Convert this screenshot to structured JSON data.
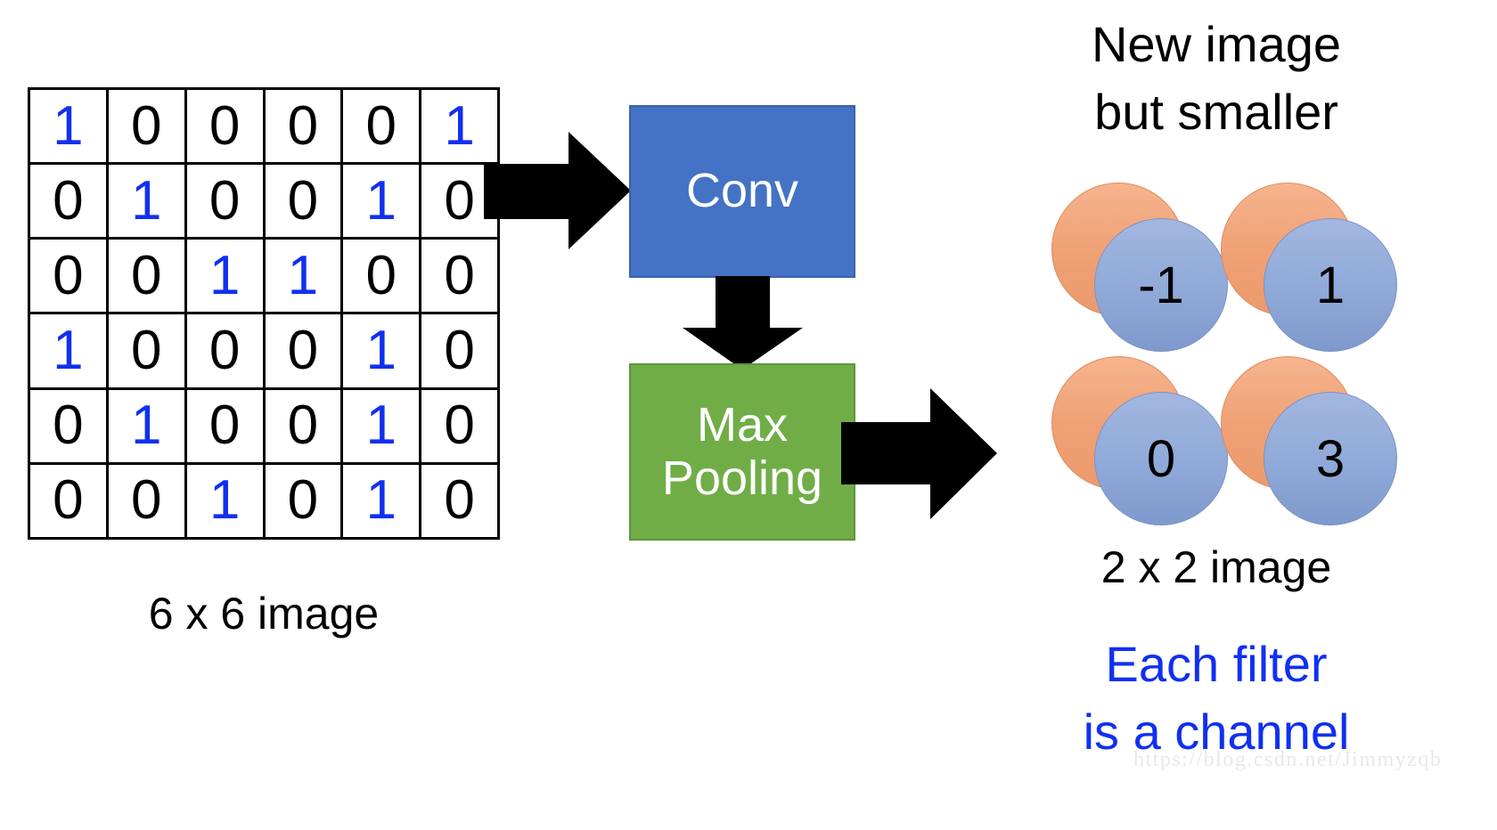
{
  "diagram": {
    "title_implicit": "CNN Conv + Max Pooling pipeline",
    "input": {
      "caption": "6 x 6 image",
      "rows": [
        [
          "1",
          "0",
          "0",
          "0",
          "0",
          "1"
        ],
        [
          "0",
          "1",
          "0",
          "0",
          "1",
          "0"
        ],
        [
          "0",
          "0",
          "1",
          "1",
          "0",
          "0"
        ],
        [
          "1",
          "0",
          "0",
          "0",
          "1",
          "0"
        ],
        [
          "0",
          "1",
          "0",
          "0",
          "1",
          "0"
        ],
        [
          "0",
          "0",
          "1",
          "0",
          "1",
          "0"
        ]
      ],
      "highlight_value": "1",
      "highlight_color": "#1030f0",
      "normal_color": "#000000"
    },
    "stages": [
      {
        "name": "conv",
        "label": "Conv",
        "lines": [
          "Conv"
        ],
        "fill": "#4472C4",
        "text_color": "#FFFFFF"
      },
      {
        "name": "max-pooling",
        "label": "Max Pooling",
        "lines": [
          "Max",
          "Pooling"
        ],
        "fill": "#70AD47",
        "text_color": "#FFFFFF"
      }
    ],
    "arrows": [
      {
        "name": "input-to-conv",
        "direction": "right",
        "color": "#000000"
      },
      {
        "name": "conv-to-pooling",
        "direction": "down",
        "color": "#000000"
      },
      {
        "name": "pooling-to-output",
        "direction": "right",
        "color": "#000000"
      }
    ],
    "output": {
      "heading_lines": [
        "New image",
        "but smaller"
      ],
      "heading_color": "#000000",
      "caption": "2 x 2 image",
      "note_lines": [
        "Each filter",
        "is a channel"
      ],
      "note_color": "#1030f0",
      "channel_colors": {
        "back": "#EFA074",
        "front": "#8FA9D8"
      },
      "cells": [
        {
          "name": "top-left",
          "front_value": "-1",
          "back_value": ""
        },
        {
          "name": "top-right",
          "front_value": "1",
          "back_value": ""
        },
        {
          "name": "bottom-left",
          "front_value": "0",
          "back_value": ""
        },
        {
          "name": "bottom-right",
          "front_value": "3",
          "back_value": ""
        }
      ]
    },
    "watermark": "https://blog.csdn.net/Jimmyzqb"
  }
}
